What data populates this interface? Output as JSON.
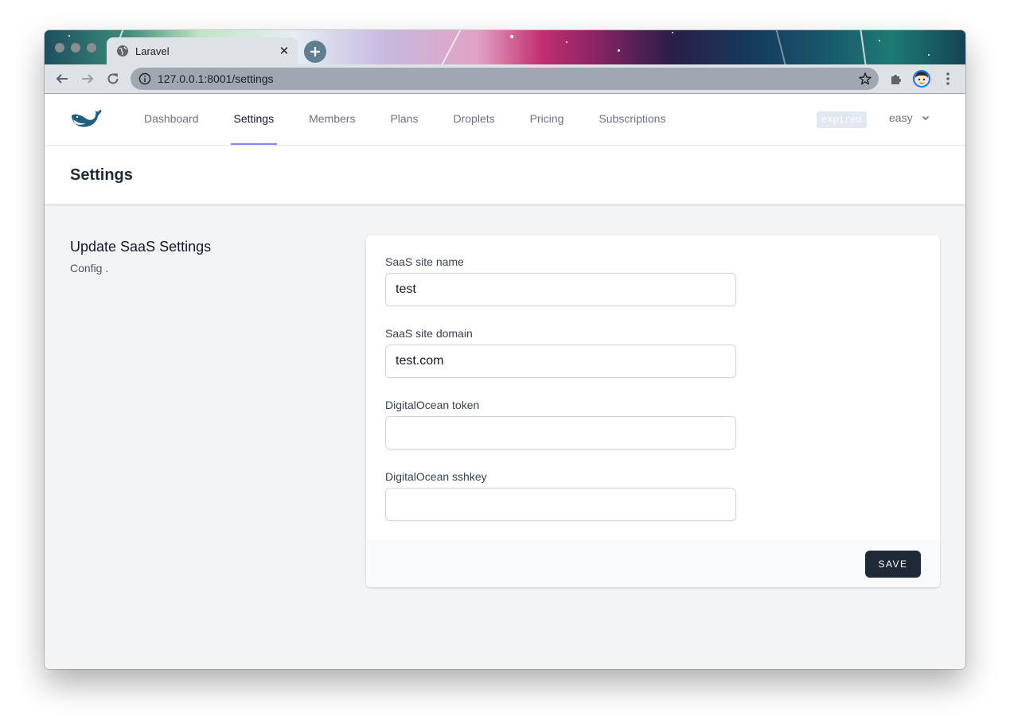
{
  "browser": {
    "tab_title": "Laravel",
    "url": "127.0.0.1:8001/settings"
  },
  "nav": {
    "links": [
      {
        "label": "Dashboard",
        "active": false
      },
      {
        "label": "Settings",
        "active": true
      },
      {
        "label": "Members",
        "active": false
      },
      {
        "label": "Plans",
        "active": false
      },
      {
        "label": "Droplets",
        "active": false
      },
      {
        "label": "Pricing",
        "active": false
      },
      {
        "label": "Subscriptions",
        "active": false
      }
    ],
    "status_badge": "expired",
    "user_name": "easy"
  },
  "header": {
    "title": "Settings"
  },
  "section": {
    "title": "Update SaaS Settings",
    "description": "Config ."
  },
  "form": {
    "fields": [
      {
        "label": "SaaS site name",
        "value": "test",
        "placeholder": ""
      },
      {
        "label": "SaaS site domain",
        "value": "test.com",
        "placeholder": ""
      },
      {
        "label": "DigitalOcean token",
        "value": "",
        "placeholder": ""
      },
      {
        "label": "DigitalOcean sshkey",
        "value": "",
        "placeholder": ""
      }
    ],
    "save_label": "SAVE"
  },
  "colors": {
    "accent": "#818cf8",
    "button": "#1f2937",
    "logo": "#1f5f7a",
    "badge": "#e2e8f0"
  }
}
